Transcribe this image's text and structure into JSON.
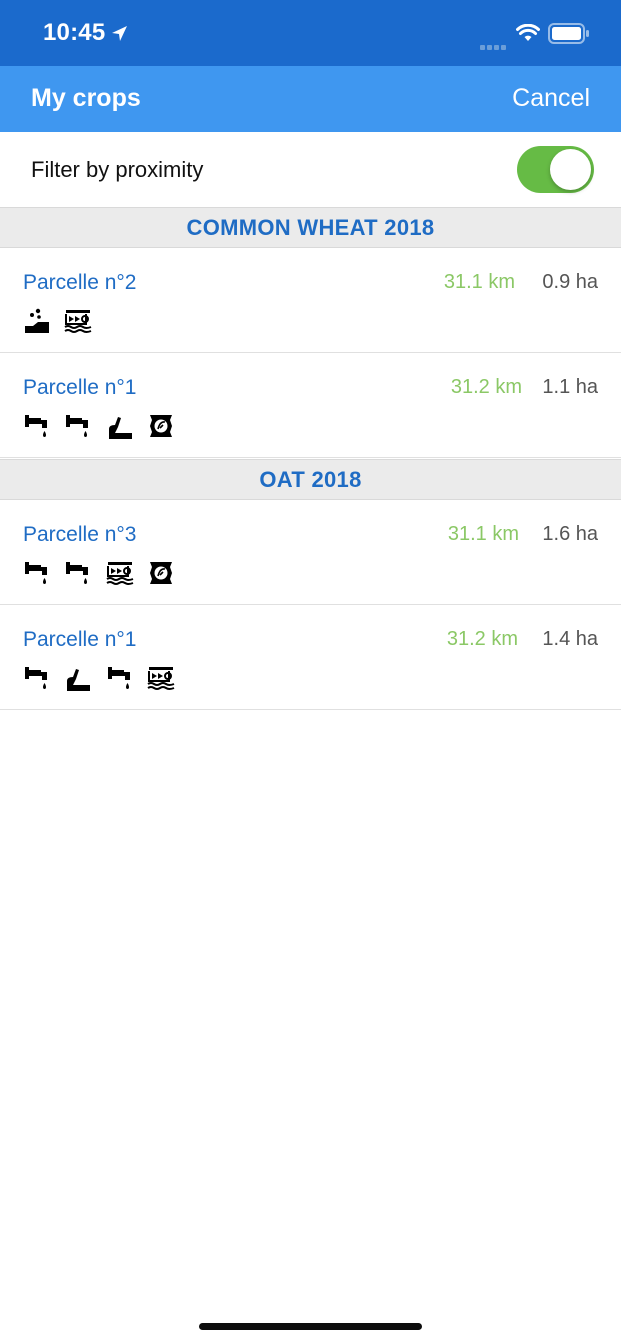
{
  "status_bar": {
    "time": "10:45"
  },
  "nav": {
    "title": "My crops",
    "cancel_label": "Cancel"
  },
  "filter": {
    "label": "Filter by proximity",
    "enabled": true
  },
  "colors": {
    "status_bar": "#1b6acc",
    "nav_bar": "#3f97f0",
    "accent_text": "#1f6cc4",
    "distance_text": "#8bc866",
    "toggle_on": "#66bb45"
  },
  "sections": [
    {
      "title": "COMMON WHEAT 2018",
      "rows": [
        {
          "name": "Parcelle n°2",
          "distance": "31.1 km",
          "area": "0.9 ha",
          "icons": [
            "sowing-icon",
            "harvester-icon"
          ]
        },
        {
          "name": "Parcelle n°1",
          "distance": "31.2 km",
          "area": "1.1 ha",
          "icons": [
            "irrigation-tap-icon",
            "irrigation-tap-icon",
            "sowing-icon",
            "fertilizer-bag-icon"
          ]
        }
      ]
    },
    {
      "title": "OAT 2018",
      "rows": [
        {
          "name": "Parcelle n°3",
          "distance": "31.1 km",
          "area": "1.6 ha",
          "icons": [
            "irrigation-tap-icon",
            "irrigation-tap-icon",
            "harvester-icon",
            "fertilizer-bag-icon"
          ]
        },
        {
          "name": "Parcelle n°1",
          "distance": "31.2 km",
          "area": "1.4 ha",
          "icons": [
            "irrigation-tap-icon",
            "sowing-icon",
            "irrigation-tap-icon",
            "harvester-icon"
          ]
        }
      ]
    }
  ]
}
